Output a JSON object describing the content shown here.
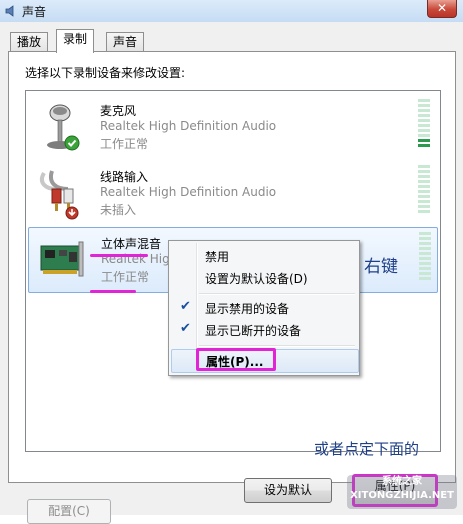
{
  "window": {
    "title": "声音",
    "close_label": "✕"
  },
  "tabs": [
    {
      "label": "播放",
      "active": false
    },
    {
      "label": "录制",
      "active": true
    },
    {
      "label": "声音",
      "active": false
    }
  ],
  "instruction": "选择以下录制设备来修改设置:",
  "devices": [
    {
      "name": "麦克风",
      "driver": "Realtek High Definition Audio",
      "status": "工作正常",
      "icon": "microphone-icon",
      "badge": "green-check",
      "meter_level": 0.15
    },
    {
      "name": "线路输入",
      "driver": "Realtek High Definition Audio",
      "status": "未插入",
      "icon": "line-in-cable-icon",
      "badge": "red-down-arrow",
      "meter_level": 0
    },
    {
      "name": "立体声混音",
      "driver": "Realtek High",
      "status": "工作正常",
      "icon": "sound-card-icon",
      "badge": "",
      "meter_level": 0
    }
  ],
  "context_menu": {
    "items": [
      {
        "label": "禁用",
        "checked": false
      },
      {
        "label": "设置为默认设备(D)",
        "checked": false
      },
      {
        "label": "显示禁用的设备",
        "checked": true
      },
      {
        "label": "显示已断开的设备",
        "checked": true
      },
      {
        "label": "属性(P)...",
        "checked": false,
        "highlighted": true
      }
    ]
  },
  "annotations": {
    "right_click": "右键",
    "or_click_below": "或者点定下面的"
  },
  "buttons": {
    "configure": "配置(C)",
    "set_default": "设为默认",
    "properties": "属性(P)"
  },
  "watermark": {
    "text": "系统之家 XITONGZHIJIA.NET"
  },
  "colors": {
    "highlight_magenta": "#e024d6",
    "annotation_blue": "#1f3f86",
    "meter_green": "#2b9a4f"
  }
}
